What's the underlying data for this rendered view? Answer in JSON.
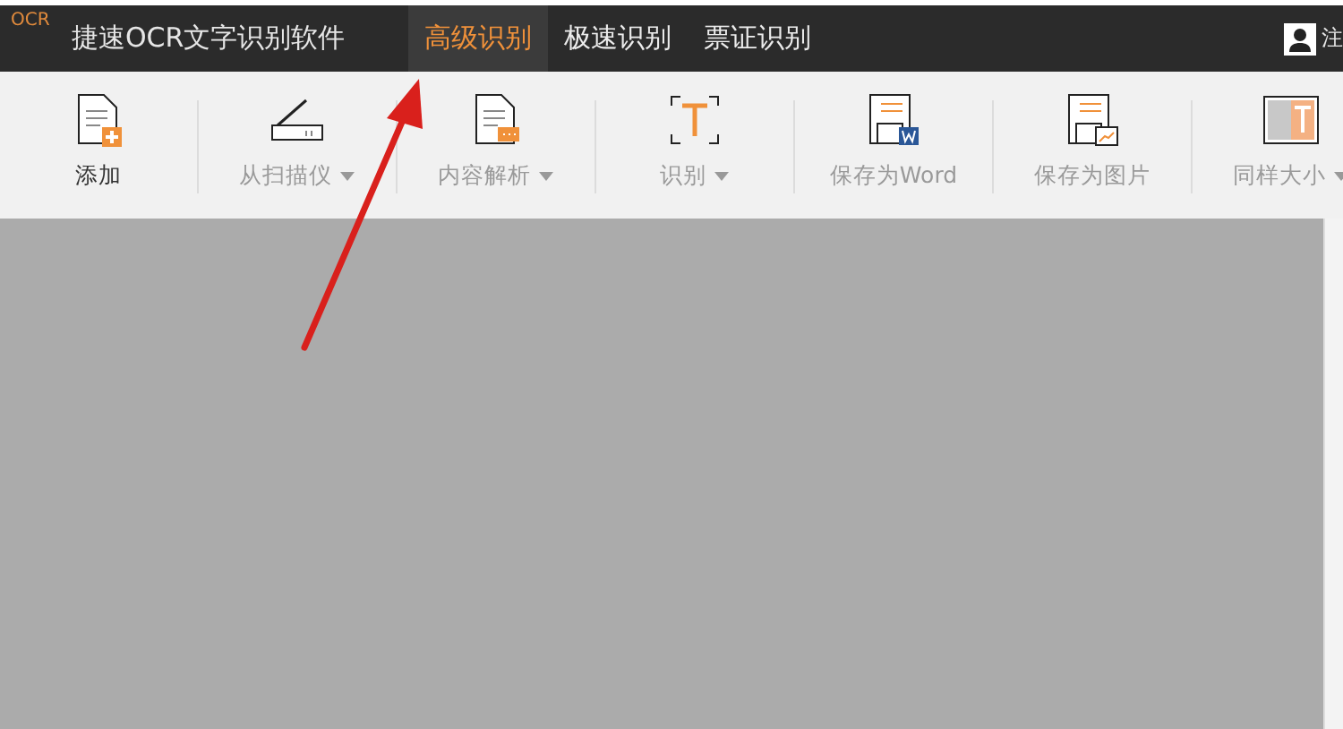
{
  "app": {
    "logo": "OCR",
    "title": "捷速OCR文字识别软件"
  },
  "tabs": [
    {
      "label": "高级识别",
      "selected": true
    },
    {
      "label": "极速识别",
      "selected": false
    },
    {
      "label": "票证识别",
      "selected": false
    }
  ],
  "user": {
    "label": "注"
  },
  "toolbar": [
    {
      "kind": "add",
      "label": "添加",
      "disabled": false,
      "dropdown": false
    },
    {
      "kind": "scanner",
      "label": "从扫描仪",
      "disabled": true,
      "dropdown": true
    },
    {
      "kind": "parse",
      "label": "内容解析",
      "disabled": true,
      "dropdown": true
    },
    {
      "kind": "recognize",
      "label": "识别",
      "disabled": true,
      "dropdown": true
    },
    {
      "kind": "word",
      "label": "保存为Word",
      "disabled": true,
      "dropdown": false
    },
    {
      "kind": "image",
      "label": "保存为图片",
      "disabled": true,
      "dropdown": false
    },
    {
      "kind": "size",
      "label": "同样大小",
      "disabled": true,
      "dropdown": true
    }
  ]
}
